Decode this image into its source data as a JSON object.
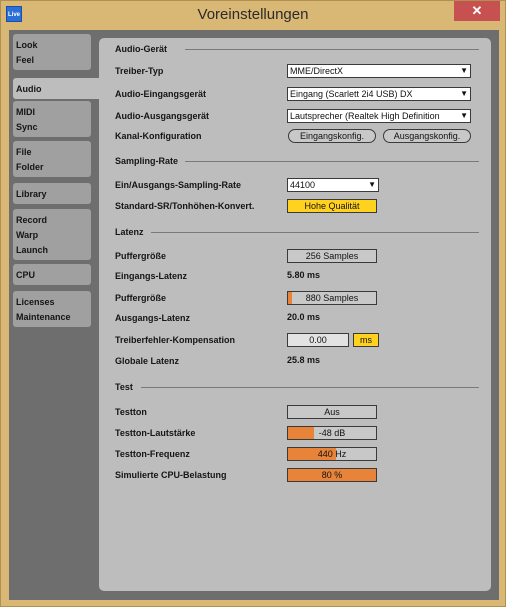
{
  "window": {
    "title": "Voreinstellungen",
    "app_icon": "Live",
    "close": "✕"
  },
  "tabs": [
    {
      "name": "look-feel",
      "lines": [
        "Look",
        "Feel"
      ]
    },
    {
      "name": "audio",
      "lines": [
        "Audio"
      ]
    },
    {
      "name": "midi-sync",
      "lines": [
        "MIDI",
        "Sync"
      ]
    },
    {
      "name": "file-folder",
      "lines": [
        "File",
        "Folder"
      ]
    },
    {
      "name": "library",
      "lines": [
        "Library"
      ]
    },
    {
      "name": "record-warp-launch",
      "lines": [
        "Record",
        "Warp",
        "Launch"
      ]
    },
    {
      "name": "cpu",
      "lines": [
        "CPU"
      ]
    },
    {
      "name": "licenses-maintenance",
      "lines": [
        "Licenses",
        "Maintenance"
      ]
    }
  ],
  "audio_device": {
    "heading": "Audio-Gerät",
    "driver_type_label": "Treiber-Typ",
    "driver_type_value": "MME/DirectX",
    "input_device_label": "Audio-Eingangsgerät",
    "input_device_value": "Eingang (Scarlett 2i4 USB) DX",
    "output_device_label": "Audio-Ausgangsgerät",
    "output_device_value": "Lautsprecher (Realtek High Definition",
    "channel_config_label": "Kanal-Konfiguration",
    "input_config_button": "Eingangskonfig.",
    "output_config_button": "Ausgangskonfig."
  },
  "sample_rate": {
    "heading": "Sampling-Rate",
    "io_rate_label": "Ein/Ausgangs-Sampling-Rate",
    "io_rate_value": "44100",
    "default_sr_label": "Standard-SR/Tonhöhen-Konvert.",
    "default_sr_value": "Hohe Qualität"
  },
  "latency": {
    "heading": "Latenz",
    "buffer_label": "Puffergröße",
    "buffer_value": "256 Samples",
    "input_latency_label": "Eingangs-Latenz",
    "input_latency_value": "5.80 ms",
    "buffer2_label": "Puffergröße",
    "buffer2_value": "880 Samples",
    "buffer2_level": 0.05,
    "output_latency_label": "Ausgangs-Latenz",
    "output_latency_value": "20.0 ms",
    "driver_error_label": "Treiberfehler-Kompensation",
    "driver_error_value": "0.00",
    "driver_error_unit": "ms",
    "overall_latency_label": "Globale Latenz",
    "overall_latency_value": "25.8 ms"
  },
  "test": {
    "heading": "Test",
    "tone_label": "Testton",
    "tone_value": "Aus",
    "volume_label": "Testton-Lautstärke",
    "volume_value": "-48 dB",
    "volume_level": 0.3,
    "freq_label": "Testton-Frequenz",
    "freq_value": "440",
    "freq_unit": "Hz",
    "freq_level": 0.55,
    "cpu_label": "Simulierte CPU-Belastung",
    "cpu_value": "80 %",
    "cpu_level": 1.0
  },
  "colors": {
    "accent_orange": "#e8843a",
    "accent_yellow": "#ffd21f",
    "frame": "#d9b774"
  }
}
